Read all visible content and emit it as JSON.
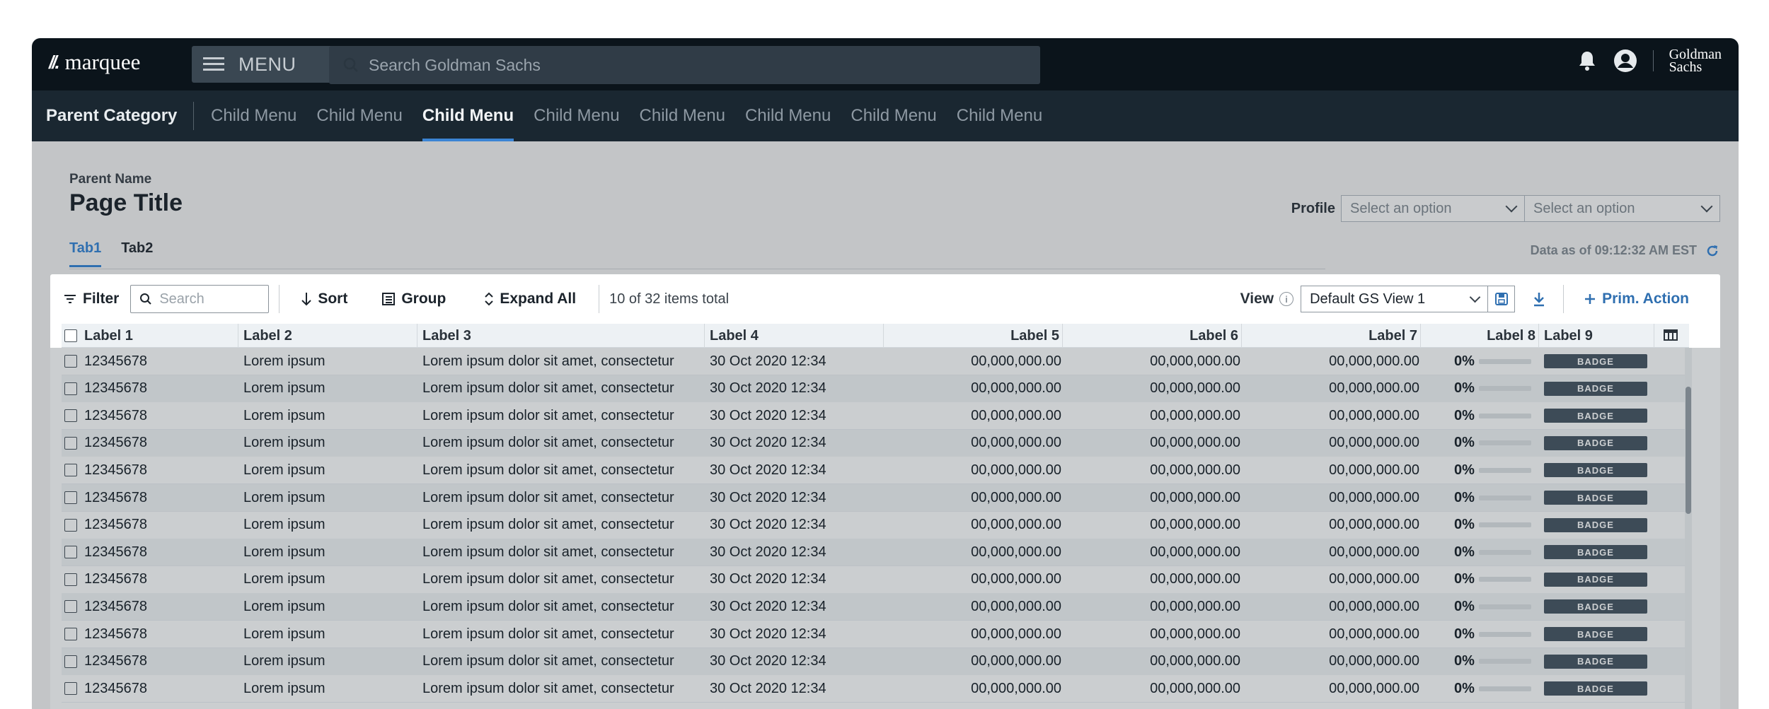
{
  "app": {
    "logo_text": "marquee",
    "logo_mark": "//.",
    "menu_label": "MENU",
    "search_placeholder": "Search Goldman Sachs",
    "brand_line1": "Goldman",
    "brand_line2": "Sachs"
  },
  "subnav": {
    "parent": "Parent Category",
    "items": [
      {
        "label": "Child Menu"
      },
      {
        "label": "Child Menu"
      },
      {
        "label": "Child Menu",
        "active": true
      },
      {
        "label": "Child Menu"
      },
      {
        "label": "Child Menu"
      },
      {
        "label": "Child Menu"
      },
      {
        "label": "Child Menu"
      },
      {
        "label": "Child Menu"
      }
    ]
  },
  "page": {
    "parent_name": "Parent Name",
    "title": "Page Title",
    "profile_label": "Profile",
    "profile_select_1": "Select an option",
    "profile_select_2": "Select an option",
    "tabs": [
      {
        "label": "Tab1",
        "active": true
      },
      {
        "label": "Tab2"
      }
    ],
    "data_as_of": "Data as of 09:12:32 AM EST"
  },
  "toolbar": {
    "filter": "Filter",
    "search_placeholder": "Search",
    "sort": "Sort",
    "group": "Group",
    "expand_all": "Expand All",
    "count": "10 of 32 items total",
    "view_label": "View",
    "view_value": "Default GS View 1",
    "primary_action": "Prim. Action"
  },
  "table": {
    "columns": [
      "Label 1",
      "Label 2",
      "Label 3",
      "Label 4",
      "Label 5",
      "Label 6",
      "Label 7",
      "Label 8",
      "Label 9"
    ],
    "rows": [
      [
        "12345678",
        "Lorem ipsum",
        "Lorem ipsum dolor sit amet, consectetur",
        "30 Oct 2020 12:34",
        "00,000,000.00",
        "00,000,000.00",
        "00,000,000.00",
        "0%",
        "BADGE"
      ],
      [
        "12345678",
        "Lorem ipsum",
        "Lorem ipsum dolor sit amet, consectetur",
        "30 Oct 2020 12:34",
        "00,000,000.00",
        "00,000,000.00",
        "00,000,000.00",
        "0%",
        "BADGE"
      ],
      [
        "12345678",
        "Lorem ipsum",
        "Lorem ipsum dolor sit amet, consectetur",
        "30 Oct 2020 12:34",
        "00,000,000.00",
        "00,000,000.00",
        "00,000,000.00",
        "0%",
        "BADGE"
      ],
      [
        "12345678",
        "Lorem ipsum",
        "Lorem ipsum dolor sit amet, consectetur",
        "30 Oct 2020 12:34",
        "00,000,000.00",
        "00,000,000.00",
        "00,000,000.00",
        "0%",
        "BADGE"
      ],
      [
        "12345678",
        "Lorem ipsum",
        "Lorem ipsum dolor sit amet, consectetur",
        "30 Oct 2020 12:34",
        "00,000,000.00",
        "00,000,000.00",
        "00,000,000.00",
        "0%",
        "BADGE"
      ],
      [
        "12345678",
        "Lorem ipsum",
        "Lorem ipsum dolor sit amet, consectetur",
        "30 Oct 2020 12:34",
        "00,000,000.00",
        "00,000,000.00",
        "00,000,000.00",
        "0%",
        "BADGE"
      ],
      [
        "12345678",
        "Lorem ipsum",
        "Lorem ipsum dolor sit amet, consectetur",
        "30 Oct 2020 12:34",
        "00,000,000.00",
        "00,000,000.00",
        "00,000,000.00",
        "0%",
        "BADGE"
      ],
      [
        "12345678",
        "Lorem ipsum",
        "Lorem ipsum dolor sit amet, consectetur",
        "30 Oct 2020 12:34",
        "00,000,000.00",
        "00,000,000.00",
        "00,000,000.00",
        "0%",
        "BADGE"
      ],
      [
        "12345678",
        "Lorem ipsum",
        "Lorem ipsum dolor sit amet, consectetur",
        "30 Oct 2020 12:34",
        "00,000,000.00",
        "00,000,000.00",
        "00,000,000.00",
        "0%",
        "BADGE"
      ],
      [
        "12345678",
        "Lorem ipsum",
        "Lorem ipsum dolor sit amet, consectetur",
        "30 Oct 2020 12:34",
        "00,000,000.00",
        "00,000,000.00",
        "00,000,000.00",
        "0%",
        "BADGE"
      ],
      [
        "12345678",
        "Lorem ipsum",
        "Lorem ipsum dolor sit amet, consectetur",
        "30 Oct 2020 12:34",
        "00,000,000.00",
        "00,000,000.00",
        "00,000,000.00",
        "0%",
        "BADGE"
      ],
      [
        "12345678",
        "Lorem ipsum",
        "Lorem ipsum dolor sit amet, consectetur",
        "30 Oct 2020 12:34",
        "00,000,000.00",
        "00,000,000.00",
        "00,000,000.00",
        "0%",
        "BADGE"
      ],
      [
        "12345678",
        "Lorem ipsum",
        "Lorem ipsum dolor sit amet, consectetur",
        "30 Oct 2020 12:34",
        "00,000,000.00",
        "00,000,000.00",
        "00,000,000.00",
        "0%",
        "BADGE"
      ]
    ]
  },
  "icons": {
    "menu": "hamburger-icon",
    "search": "search-icon",
    "bell": "bell-icon",
    "user": "user-icon",
    "refresh": "refresh-icon",
    "filter": "filter-icon",
    "sort": "sort-arrow-icon",
    "group": "group-icon",
    "expand": "expand-icon",
    "info": "info-icon",
    "save": "save-icon",
    "download": "download-icon",
    "plus": "plus-icon",
    "columns": "columns-icon"
  },
  "colors": {
    "topbar": "#0b141b",
    "subnav": "#1a2731",
    "accent": "#2f6fb0",
    "badge": "#4a5865"
  }
}
